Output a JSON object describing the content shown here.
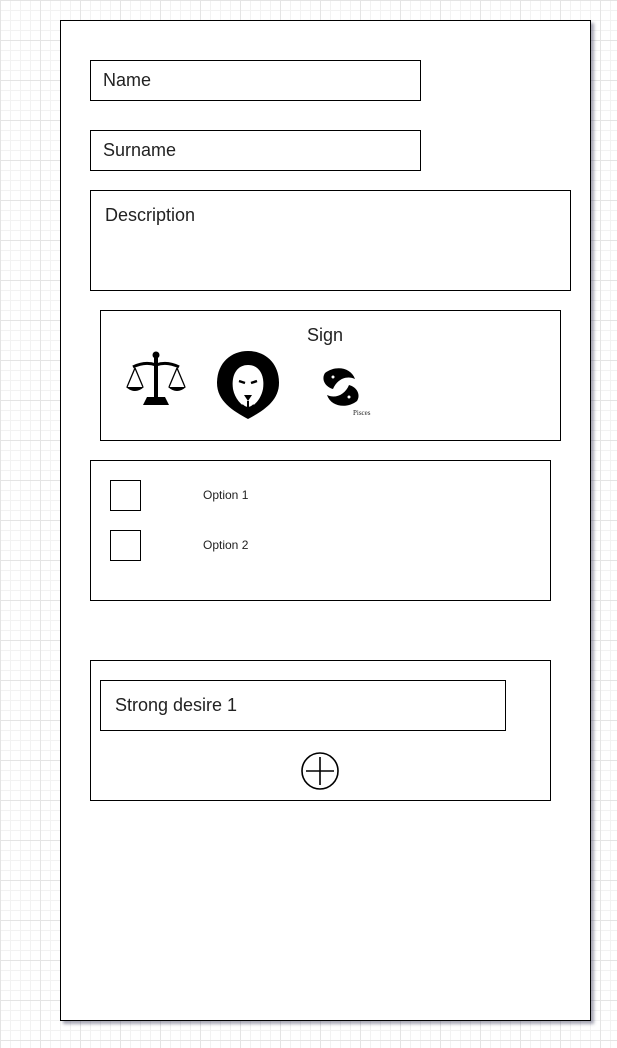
{
  "form": {
    "name_placeholder": "Name",
    "surname_placeholder": "Surname",
    "description_placeholder": "Description",
    "sign": {
      "title": "Sign",
      "icons": [
        "libra-icon",
        "leo-icon",
        "pisces-icon"
      ],
      "pisces_caption": "Pisces"
    },
    "options": [
      {
        "label": "Option 1"
      },
      {
        "label": "Option 2"
      }
    ],
    "desires": {
      "items": [
        "Strong desire 1"
      ],
      "add_icon": "plus-circle-icon"
    }
  }
}
